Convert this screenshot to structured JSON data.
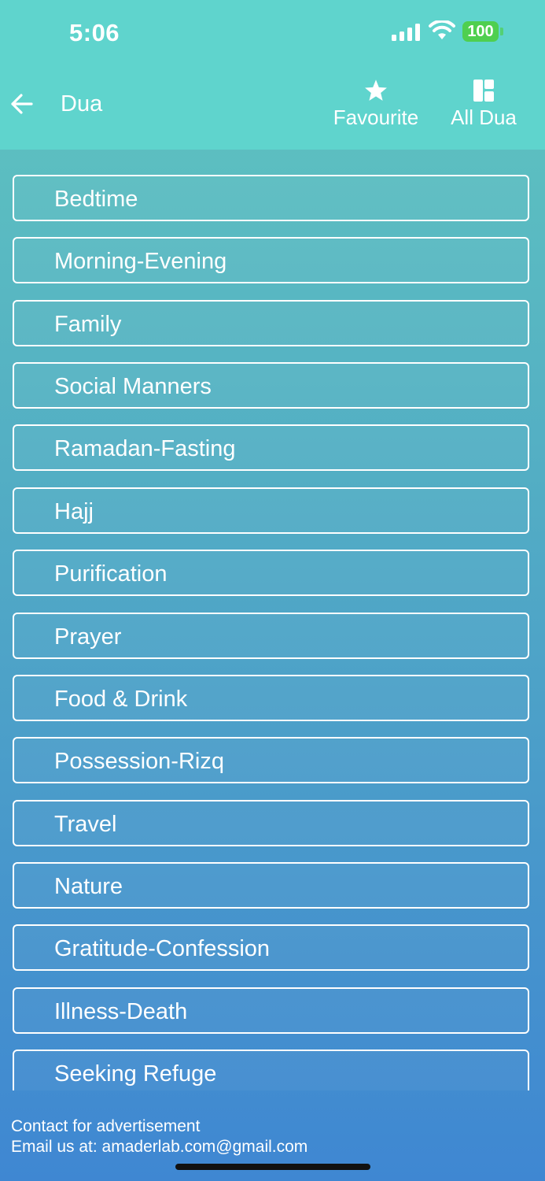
{
  "status_bar": {
    "time": "5:06",
    "battery": "100",
    "battery_color": "#4fcf4f"
  },
  "app_bar": {
    "back_icon": "arrow-left-icon",
    "title": "Dua",
    "favourite_label": "Favourite",
    "favourite_icon": "star-icon",
    "all_dua_label": "All Dua",
    "all_dua_icon": "dashboard-icon",
    "background": "#5fd4cd"
  },
  "categories": [
    {
      "label": "Bedtime"
    },
    {
      "label": "Morning-Evening"
    },
    {
      "label": "Family"
    },
    {
      "label": "Social Manners"
    },
    {
      "label": "Ramadan-Fasting"
    },
    {
      "label": "Hajj"
    },
    {
      "label": "Purification"
    },
    {
      "label": "Prayer"
    },
    {
      "label": "Food & Drink"
    },
    {
      "label": "Possession-Rizq"
    },
    {
      "label": "Travel"
    },
    {
      "label": "Nature"
    },
    {
      "label": "Gratitude-Confession"
    },
    {
      "label": "Illness-Death"
    },
    {
      "label": "Seeking Refuge"
    }
  ],
  "footer": {
    "line1": "Contact for advertisement",
    "line2": "Email us at: amaderlab.com@gmail.com"
  }
}
